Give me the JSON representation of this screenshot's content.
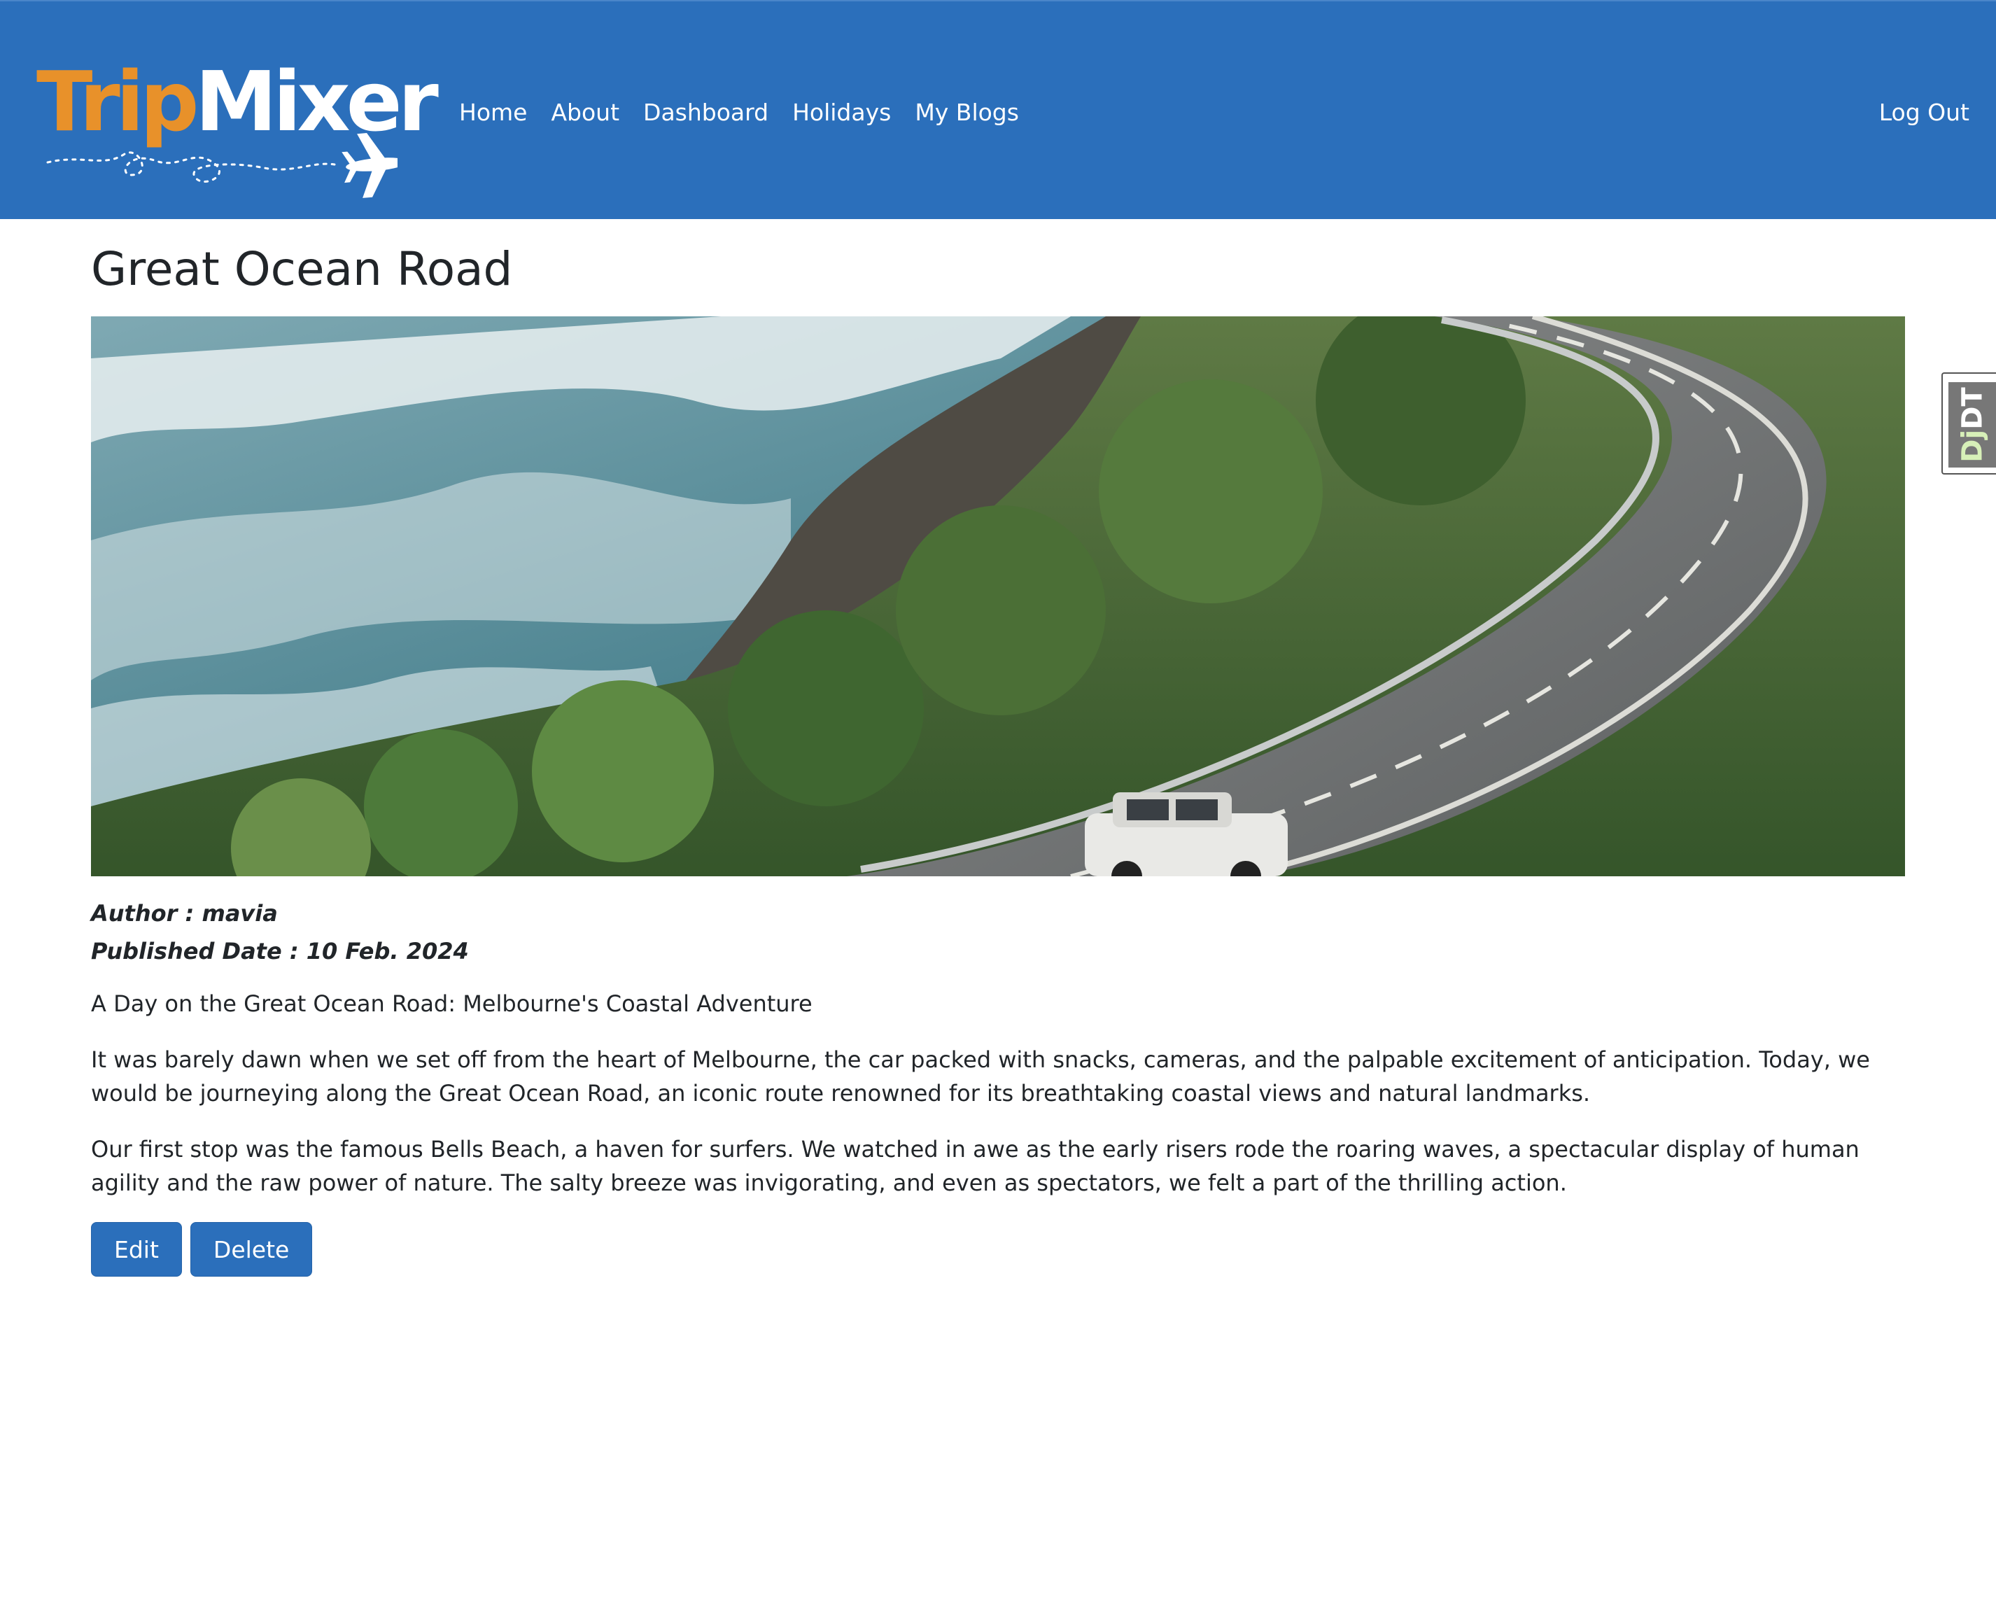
{
  "brand": {
    "logo_part1": "Trip",
    "logo_part2": "Mixer",
    "colors": {
      "navbar": "#2b6fbb",
      "logo_accent": "#e8912a",
      "button": "#2b6fbb"
    }
  },
  "nav": {
    "items": [
      "Home",
      "About",
      "Dashboard",
      "Holidays",
      "My Blogs"
    ],
    "logout": "Log Out"
  },
  "post": {
    "title": "Great Ocean Road",
    "image_icon": "coastal-road-photo",
    "author": "Author : mavia",
    "published": "Published Date : 10 Feb. 2024",
    "paragraphs": [
      "A Day on the Great Ocean Road: Melbourne's Coastal Adventure",
      "It was barely dawn when we set off from the heart of Melbourne, the car packed with snacks, cameras, and the palpable excitement of anticipation. Today, we would be journeying along the Great Ocean Road, an iconic route renowned for its breathtaking coastal views and natural landmarks.",
      "Our first stop was the famous Bells Beach, a haven for surfers. We watched in awe as the early risers rode the roaring waves, a spectacular display of human agility and the raw power of nature. The salty breeze was invigorating, and even as spectators, we felt a part of the thrilling action."
    ]
  },
  "actions": {
    "edit": "Edit",
    "delete": "Delete"
  },
  "debug_toolbar": {
    "dj": "Dj",
    "dt": "DT"
  }
}
